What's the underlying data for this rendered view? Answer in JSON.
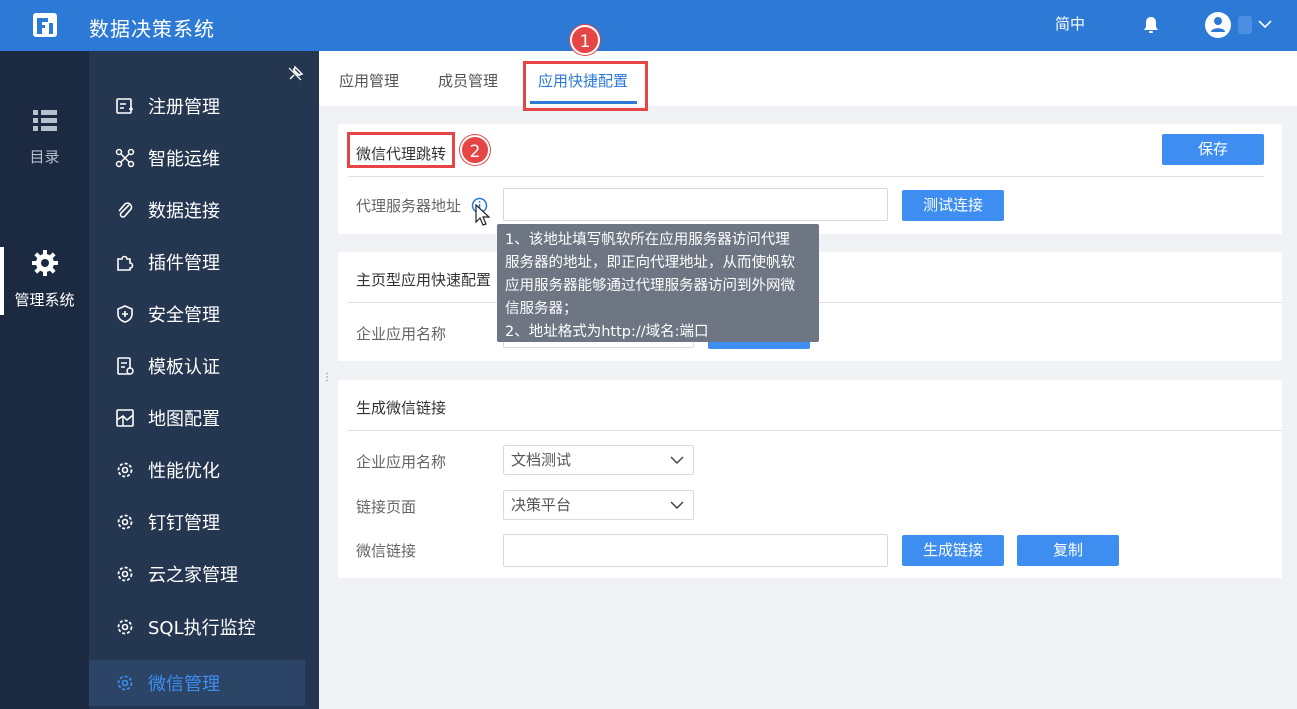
{
  "app": {
    "title": "数据决策系统",
    "language": "简中"
  },
  "rail": {
    "items": [
      {
        "label": "目录",
        "icon": "list-icon"
      },
      {
        "label": "管理系统",
        "icon": "gear-icon"
      }
    ]
  },
  "sidebar": {
    "items": [
      {
        "label": "注册管理",
        "icon": "register-icon"
      },
      {
        "label": "智能运维",
        "icon": "ops-icon"
      },
      {
        "label": "数据连接",
        "icon": "paperclip-icon"
      },
      {
        "label": "插件管理",
        "icon": "plugin-icon"
      },
      {
        "label": "安全管理",
        "icon": "shield-icon"
      },
      {
        "label": "模板认证",
        "icon": "template-icon"
      },
      {
        "label": "地图配置",
        "icon": "map-icon"
      },
      {
        "label": "性能优化",
        "icon": "gear-icon"
      },
      {
        "label": "钉钉管理",
        "icon": "gear-icon"
      },
      {
        "label": "云之家管理",
        "icon": "gear-icon"
      },
      {
        "label": "SQL执行监控",
        "icon": "gear-icon"
      },
      {
        "label": "微信管理",
        "icon": "gear-icon"
      }
    ],
    "active": "微信管理"
  },
  "tabs": [
    {
      "label": "应用管理"
    },
    {
      "label": "成员管理"
    },
    {
      "label": "应用快捷配置"
    }
  ],
  "annotations": {
    "badge1": "1",
    "badge2": "2"
  },
  "proxy": {
    "title": "微信代理跳转",
    "save": "保存",
    "label": "代理服务器地址",
    "input_value": "",
    "test_button": "测试连接",
    "tooltip_line1": "1、该地址填写帆软所在应用服务器访问代理",
    "tooltip_line2": "服务器的地址，即正向代理地址，从而使帆软",
    "tooltip_line3": "应用服务器能够通过代理服务器访问到外网微",
    "tooltip_line4": "信服务器；",
    "tooltip_line5": "2、地址格式为http://域名:端口"
  },
  "homepage": {
    "title": "主页型应用快速配置",
    "label": "企业应用名称"
  },
  "link": {
    "title": "生成微信链接",
    "app_label": "企业应用名称",
    "app_value": "文档测试",
    "page_label": "链接页面",
    "page_value": "决策平台",
    "wechat_label": "微信链接",
    "wechat_value": "",
    "generate_button": "生成链接",
    "copy_button": "复制"
  },
  "colors": {
    "primary": "#2d79d6",
    "button": "#3d8ef0",
    "highlight": "#e64545",
    "rail": "#1c2a41",
    "sidebar": "#243650"
  }
}
